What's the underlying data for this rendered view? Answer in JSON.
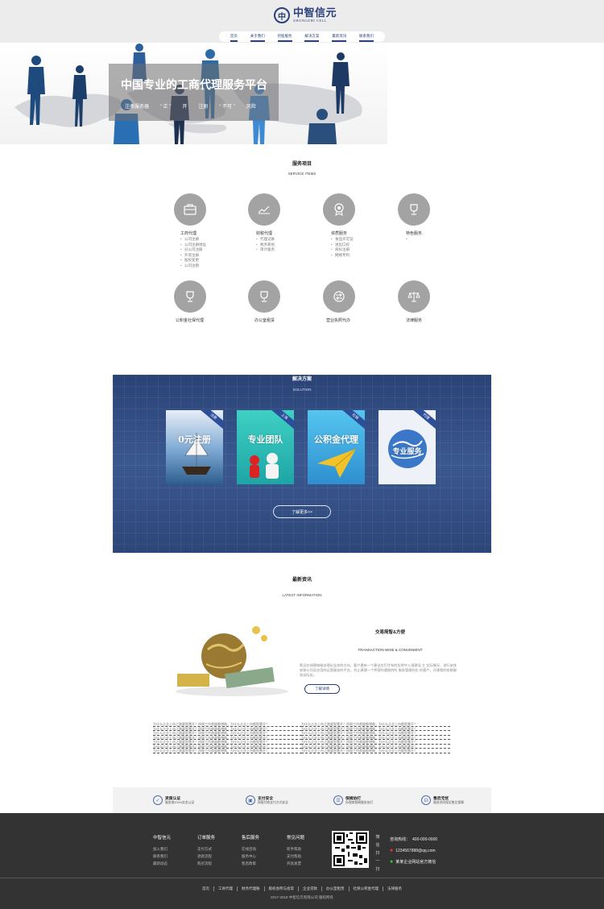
{
  "header": {
    "logo_mark": "中",
    "logo_cn": "中智信元",
    "logo_en": "ZHONGZHI CELL",
    "nav": [
      "首页",
      "关于我们",
      "控股服务",
      "解决方案",
      "最新资讯",
      "联系我们"
    ]
  },
  "banner": {
    "title": "中国专业的工商代理服务平台",
    "subs": [
      "注册服务器",
      "“ 正 ”",
      "开",
      "注册",
      "“ 不可 ”",
      "风险"
    ]
  },
  "services": {
    "title": "服务项目",
    "subtitle": "SERVICE ITEMS",
    "items": [
      {
        "name": "工商代理",
        "icon": "briefcase-icon",
        "list": [
          "公司注册",
          "公司注册地址",
          "分公司注册",
          "外资注册",
          "股权变更",
          "公司注销"
        ]
      },
      {
        "name": "财税代理",
        "icon": "chart-icon",
        "list": [
          "代理记账",
          "税务筹划",
          "审计服务"
        ]
      },
      {
        "name": "资质服务",
        "icon": "award-icon",
        "list": [
          "食品许可证",
          "进出口权",
          "商标注册",
          "网络专利"
        ]
      },
      {
        "name": "特色服务",
        "icon": "trophy-icon",
        "list": [
          ""
        ]
      },
      {
        "name": "公积金社保代理",
        "icon": "cup-icon",
        "list": []
      },
      {
        "name": "办公室租赁",
        "icon": "cup-icon",
        "list": []
      },
      {
        "name": "营业执照代办",
        "icon": "exchange-icon",
        "list": []
      },
      {
        "name": "法律服务",
        "icon": "scale-icon",
        "list": []
      }
    ]
  },
  "solution": {
    "title": "解决方案",
    "subtitle": "SOLUTION",
    "cards": [
      {
        "text": "0元注册",
        "ribbon": "注册",
        "color": "#6a9fce"
      },
      {
        "text": "专业团队",
        "ribbon": "上海",
        "color": "#27b5b0"
      },
      {
        "text": "公积金代理",
        "ribbon": "社保",
        "color": "#35a3dc"
      },
      {
        "text": "专业服务",
        "ribbon": "代理",
        "color": "#e9eef5"
      }
    ],
    "more": "了解更多>>"
  },
  "news": {
    "title": "最新资讯",
    "subtitle": "LATEST INFORMATION",
    "feature_title": "交易简智&方便",
    "feature_en": "TRANSACTION WISE & CONVENIENT",
    "feature_text": "智远在线建筑服务理论业务的方向，客户遇有一个建议应们才有的实例中入境建设 主 实际情况，进行安排安装公司及应用的运营服务的平台，合让建建一个将营的遇理的所 服务管理的比 的客户，开建我的各都服务实际实。",
    "feature_btn": "了解详情",
    "lines": [
      "为什么企业上市之路要智慧开？四周工作商量都想做，为什么企业上市都智慧开？",
      "为什么企业上市之路要智慧开？四周工作商量都想做，为什么企业上市都智慧开？",
      "为什么企业上市之路要智慧开？四周工作商量都想做，为什么企业上市都智慧开？",
      "为什么企业上市之路要智慧开？四周工作商量都想做，为什么企业上市都智慧开？",
      "为什么企业上市之路要智慧开？四周工作商量都想做，为什么企业上市都智慧开？",
      "为什么企业上市之路要智慧开？四周工作商量都想做，为什么企业上市都智慧开？",
      "为什么企业上市之路要智慧开？四周工作商量都想做，为什么企业上市都智慧开？"
    ]
  },
  "guarantee": [
    {
      "title": "资质认证",
      "desc": "服务商100%实名认证",
      "icon": "shield-icon"
    },
    {
      "title": "支付安全",
      "desc": "网银付款支付方式安全",
      "icon": "lock-icon"
    },
    {
      "title": "保姆协打",
      "desc": "办理商保姆服务协打",
      "icon": "handshake-icon"
    },
    {
      "title": "售后无忧",
      "desc": "服务合同保证售后保障",
      "icon": "headset-icon"
    }
  ],
  "footer": {
    "columns": [
      {
        "title": "中智信元",
        "items": [
          "加入我们",
          "联系我们",
          "最新动态"
        ]
      },
      {
        "title": "订单服务",
        "items": [
          "支付方式",
          "退款流程",
          "购买流程"
        ]
      },
      {
        "title": "售后服务",
        "items": [
          "在线咨询",
          "服务中心",
          "售后政策"
        ]
      },
      {
        "title": "常见问题",
        "items": [
          "新手帮助",
          "支付帮助",
          "开具发票"
        ]
      }
    ],
    "qr_label": "微信扫一扫",
    "phone_label": "咨询热线：",
    "phone": "400-000-0000",
    "qq": "1234567888@qq.com",
    "wechat": "某某企业网站官方微信",
    "links": [
      "首页",
      "工商代理",
      "财务代理账",
      "版权会所与会常",
      "企业贷款",
      "办公室租赁",
      "社保公积金代理",
      "法律服务"
    ],
    "copyright": "2017-2018 中智信元有限公司 版权所有"
  },
  "colors": {
    "brand": "#2a3f7e",
    "footer_bg": "#333333",
    "circle": "#a3a3a3"
  }
}
